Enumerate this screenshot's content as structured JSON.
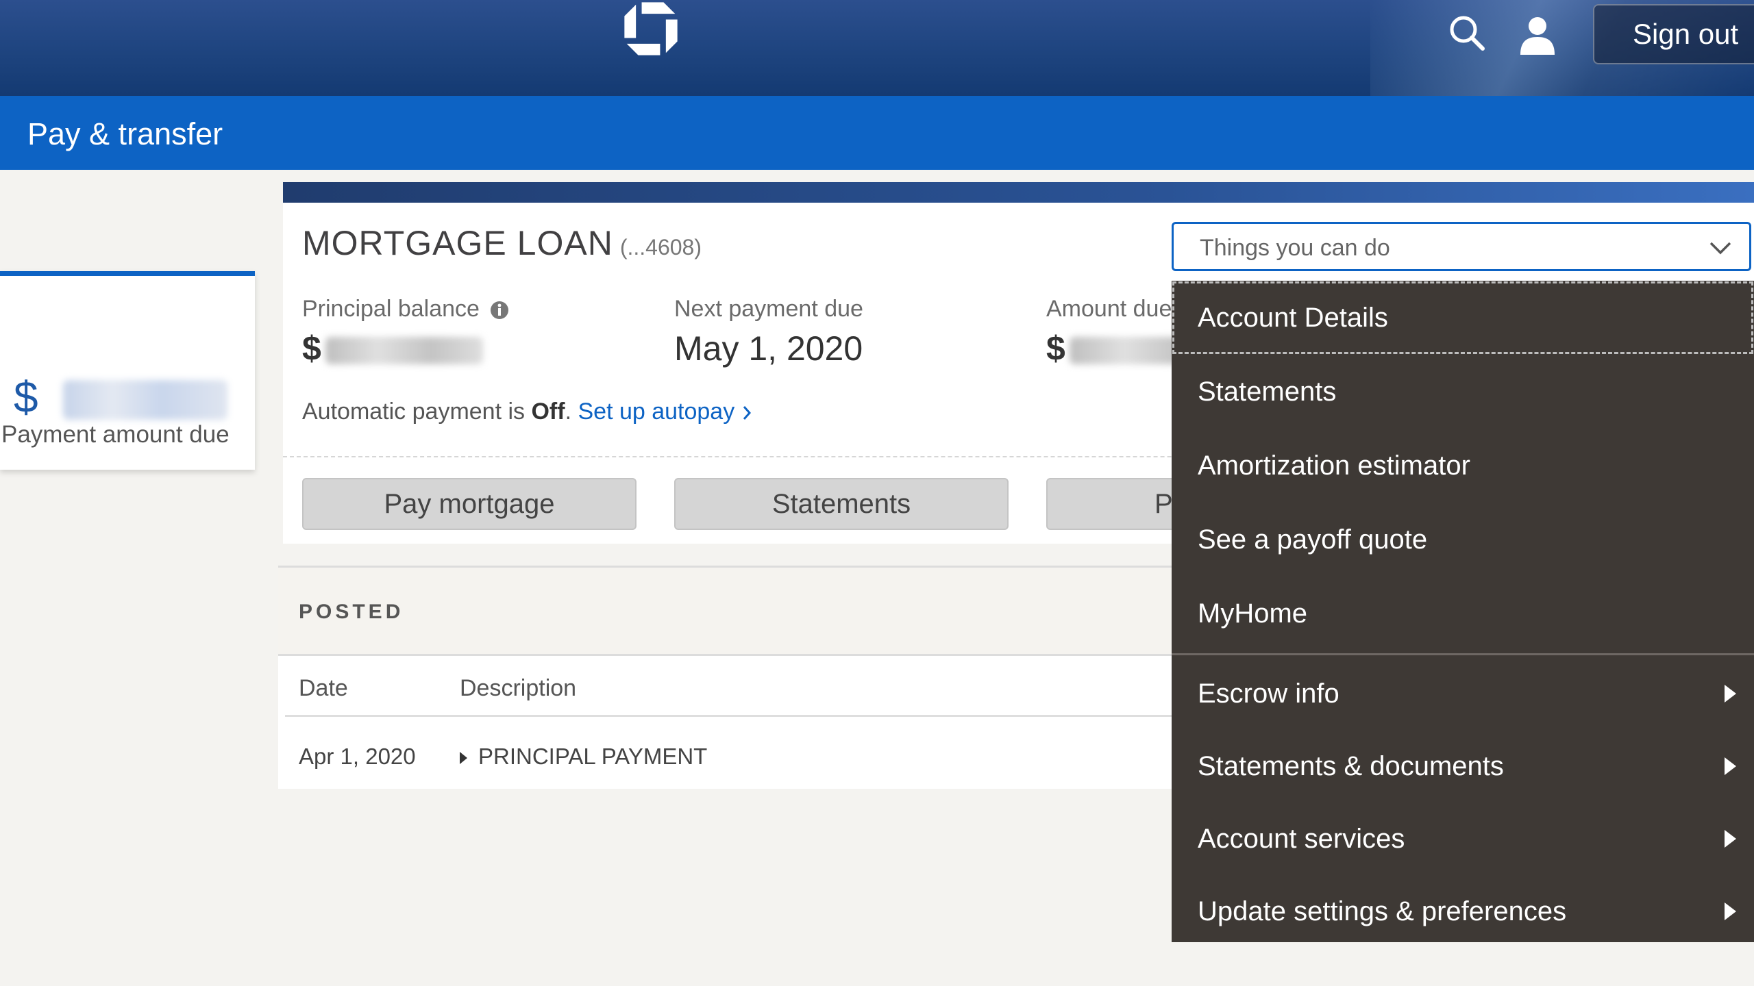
{
  "header": {
    "signout_label": "Sign out"
  },
  "subnav": {
    "title": "Pay & transfer"
  },
  "summary_card": {
    "currency_symbol": "$",
    "label": "Payment amount due"
  },
  "account": {
    "title": "MORTGAGE LOAN",
    "number": "(...4608)",
    "principal_label": "Principal balance",
    "principal_value_prefix": "$",
    "next_due_label": "Next payment due",
    "next_due_value": "May 1, 2020",
    "amount_due_label": "Amount due",
    "amount_due_value_prefix": "$",
    "autopay_prefix": "Automatic payment is ",
    "autopay_status": "Off",
    "autopay_suffix": ".",
    "autopay_link": "Set up autopay",
    "buttons": [
      "Pay mortgage",
      "Statements",
      "P"
    ]
  },
  "transactions": {
    "section_label": "POSTED",
    "columns": [
      "Date",
      "Description"
    ],
    "rows": [
      {
        "date": "Apr 1, 2020",
        "description": "PRINCIPAL PAYMENT"
      }
    ]
  },
  "dropdown": {
    "label": "Things you can do",
    "items": [
      "Account Details",
      "Statements",
      "Amortization estimator",
      "See a payoff quote",
      "MyHome"
    ],
    "submenus": [
      "Escrow info",
      "Statements & documents",
      "Account services",
      "Update settings & preferences"
    ]
  },
  "colors": {
    "brand_blue": "#0d63c4",
    "header_navy": "#1e447f",
    "menu_bg": "#3e3935"
  }
}
